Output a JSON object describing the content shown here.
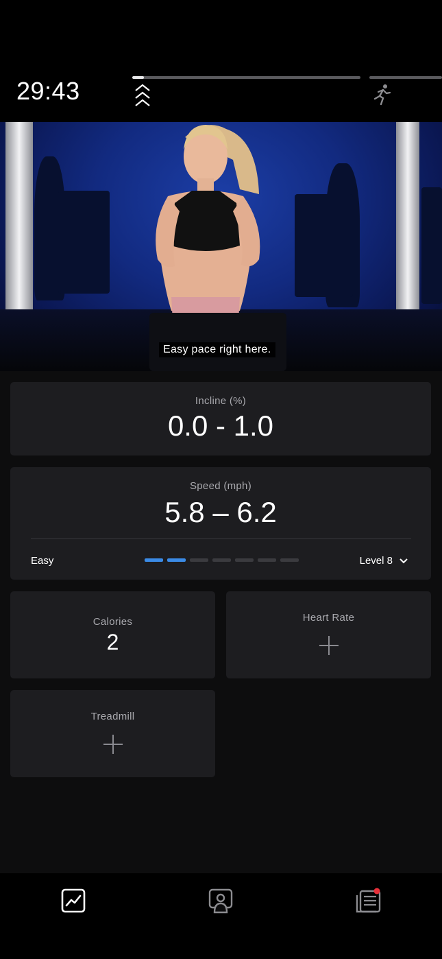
{
  "header": {
    "timer": "29:43",
    "progress_fraction": 0.05
  },
  "video": {
    "caption": "Easy pace right here."
  },
  "incline": {
    "label": "Incline (%)",
    "value": "0.0 - 1.0"
  },
  "speed": {
    "label": "Speed (mph)",
    "value": "5.8 – 6.2",
    "difficulty_label": "Easy",
    "segments_total": 7,
    "segments_active": 2,
    "level_label": "Level 8"
  },
  "calories": {
    "label": "Calories",
    "value": "2"
  },
  "heart_rate": {
    "label": "Heart Rate"
  },
  "treadmill": {
    "label": "Treadmill"
  },
  "colors": {
    "accent": "#3b8be6",
    "notification": "#e8303a"
  },
  "nav": {
    "items": [
      "metrics-icon",
      "instructor-view-icon",
      "class-details-icon"
    ]
  }
}
